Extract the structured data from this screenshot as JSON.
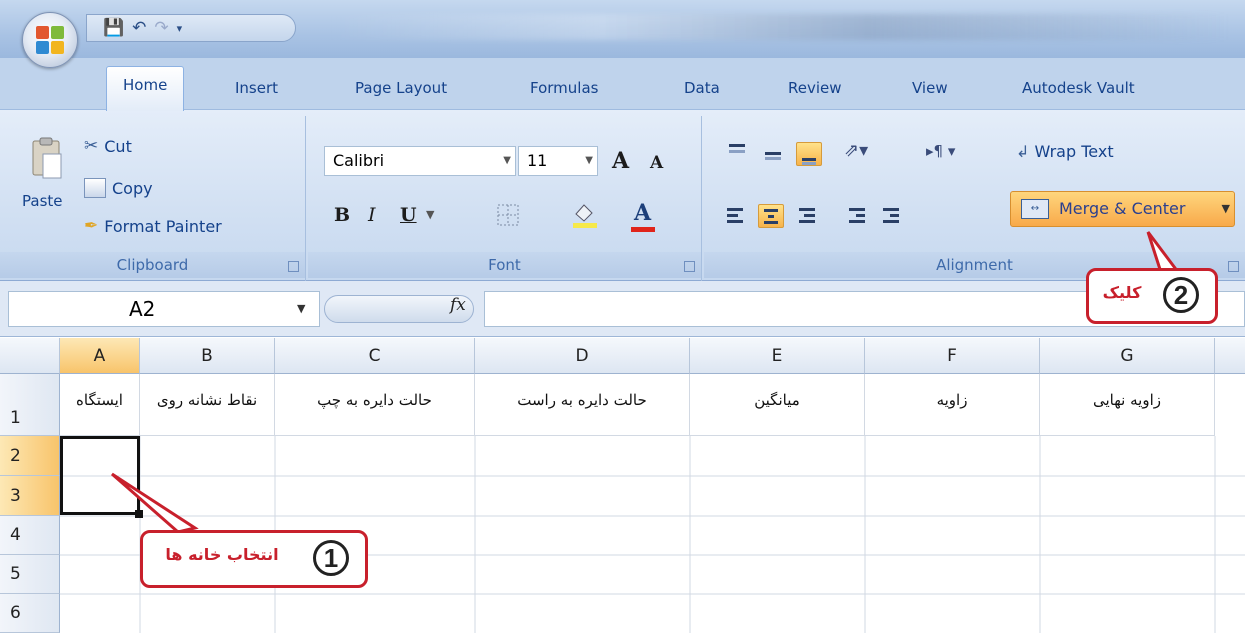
{
  "titlebar": {
    "quick_access": [
      "save-icon",
      "undo-icon",
      "redo-icon"
    ]
  },
  "tabs": [
    "Home",
    "Insert",
    "Page Layout",
    "Formulas",
    "Data",
    "Review",
    "View",
    "Autodesk Vault"
  ],
  "active_tab": "Home",
  "clipboard": {
    "paste": "Paste",
    "cut": "Cut",
    "copy": "Copy",
    "format_painter": "Format Painter",
    "label": "Clipboard"
  },
  "font": {
    "name": "Calibri",
    "size": "11",
    "grow": "A",
    "shrink": "A",
    "bold": "B",
    "italic": "I",
    "underline": "U",
    "font_color": "A",
    "label": "Font"
  },
  "alignment": {
    "wrap_text": "Wrap Text",
    "merge_center": "Merge & Center",
    "label": "Alignment"
  },
  "formula_bar": {
    "name_box": "A2",
    "fx": "fx",
    "formula": ""
  },
  "grid": {
    "columns": [
      "A",
      "B",
      "C",
      "D",
      "E",
      "F",
      "G"
    ],
    "rows": [
      "1",
      "2",
      "3",
      "4",
      "5",
      "6"
    ],
    "row1": [
      "ایستگاه",
      "نقاط نشانه روی",
      "حالت دایره به چپ",
      "حالت دایره به راست",
      "میانگین",
      "زاویه",
      "زاویه نهایی"
    ],
    "selected_cell": "A2"
  },
  "annotations": {
    "step1_number": "1",
    "step1_text": "انتخاب خانه ها",
    "step2_number": "2",
    "step2_text": "کلیک"
  },
  "colors": {
    "accent_orange": "#f8a94a",
    "callout_red": "#c8202c",
    "ribbon_blue": "#d3e1f3"
  }
}
